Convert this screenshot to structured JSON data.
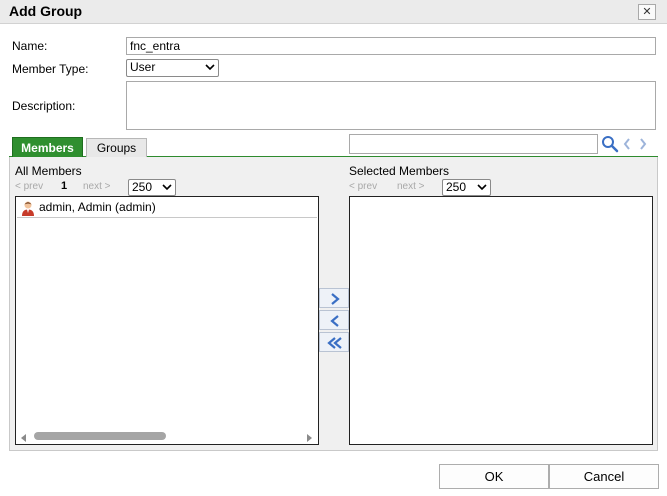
{
  "dialog": {
    "title": "Add Group",
    "close_glyph": "✕"
  },
  "form": {
    "name_label": "Name:",
    "name_value": "fnc_entra",
    "member_type_label": "Member Type:",
    "member_type_value": "User",
    "description_label": "Description:",
    "description_value": ""
  },
  "tabs": [
    {
      "label": "Members",
      "active": true
    },
    {
      "label": "Groups",
      "active": false
    }
  ],
  "search": {
    "value": ""
  },
  "all_members": {
    "heading": "All Members",
    "pager": {
      "prev": "< prev",
      "current": "1",
      "next": "next >",
      "page_size": "250"
    },
    "items": [
      {
        "label": "admin, Admin (admin)"
      }
    ]
  },
  "selected_members": {
    "heading": "Selected Members",
    "pager": {
      "prev": "< prev",
      "next": "next >",
      "page_size": "250"
    },
    "items": []
  },
  "footer": {
    "ok_label": "OK",
    "cancel_label": "Cancel"
  },
  "colors": {
    "active_tab": "#2f8f2f",
    "move_arrow": "#3a6fc4"
  }
}
